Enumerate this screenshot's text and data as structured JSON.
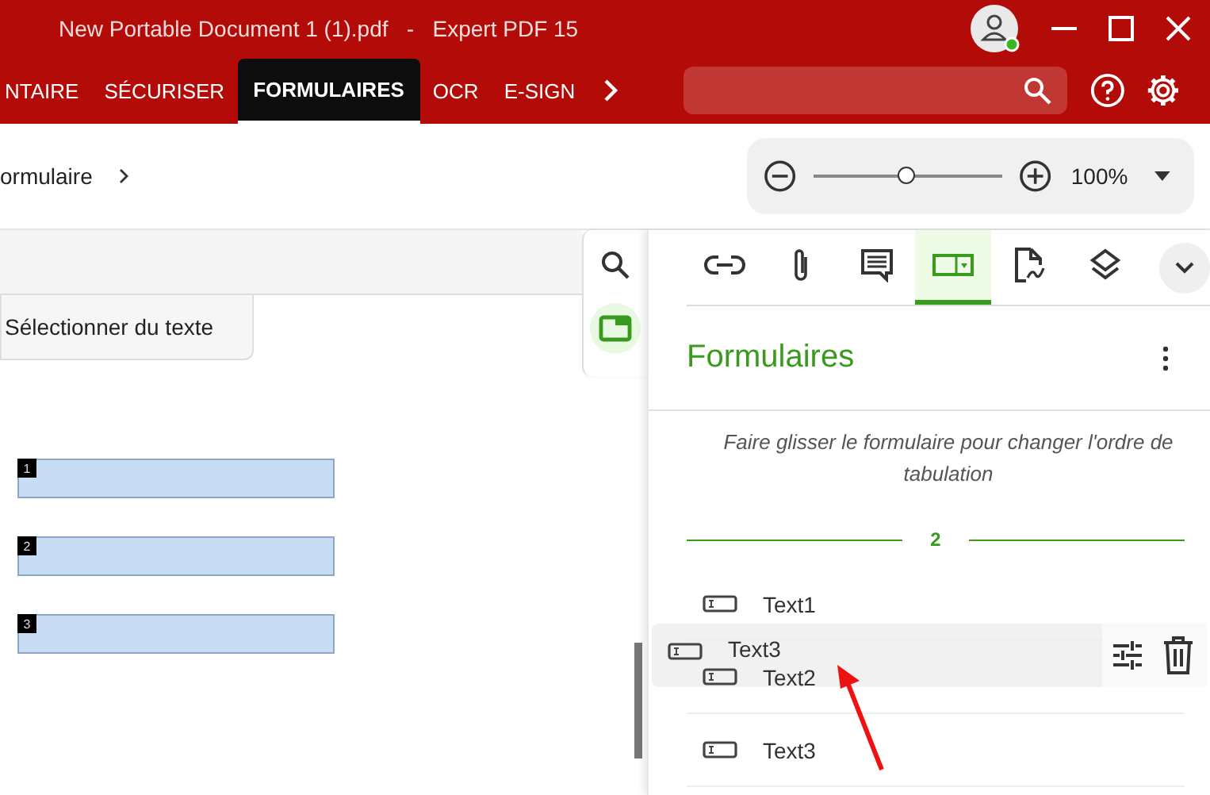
{
  "window": {
    "title": "New Portable Document 1 (1).pdf   -   Expert PDF 15"
  },
  "ribbon": {
    "tabs": [
      {
        "label": "NTAIRE",
        "selected": false
      },
      {
        "label": "SÉCURISER",
        "selected": false
      },
      {
        "label": "FORMULAIRES",
        "selected": true
      },
      {
        "label": "OCR",
        "selected": false
      },
      {
        "label": "E-SIGN",
        "selected": false
      }
    ]
  },
  "breadcrumb": {
    "text": "ormulaire"
  },
  "zoom": {
    "level": 0.5,
    "reading": "100%"
  },
  "document": {
    "tool_tab": "Sélectionner du texte",
    "fields": [
      {
        "number": "1"
      },
      {
        "number": "2"
      },
      {
        "number": "3"
      }
    ]
  },
  "side_strip": [
    {
      "kind": "search",
      "selected": false
    },
    {
      "kind": "forms",
      "selected": true
    }
  ],
  "panel": {
    "tabs": [
      {
        "kind": "link",
        "selected": false
      },
      {
        "kind": "attachment",
        "selected": false
      },
      {
        "kind": "comment",
        "selected": false
      },
      {
        "kind": "forms",
        "selected": true
      },
      {
        "kind": "signature",
        "selected": false
      },
      {
        "kind": "layers",
        "selected": false
      }
    ],
    "title": "Formulaires",
    "hint": "Faire glisser le formulaire pour changer l'ordre de tabulation",
    "page": "2",
    "items": [
      {
        "label": "Text1"
      },
      {
        "label": "Text2"
      },
      {
        "label": "Text3"
      }
    ],
    "dragged": {
      "label": "Text3"
    }
  }
}
